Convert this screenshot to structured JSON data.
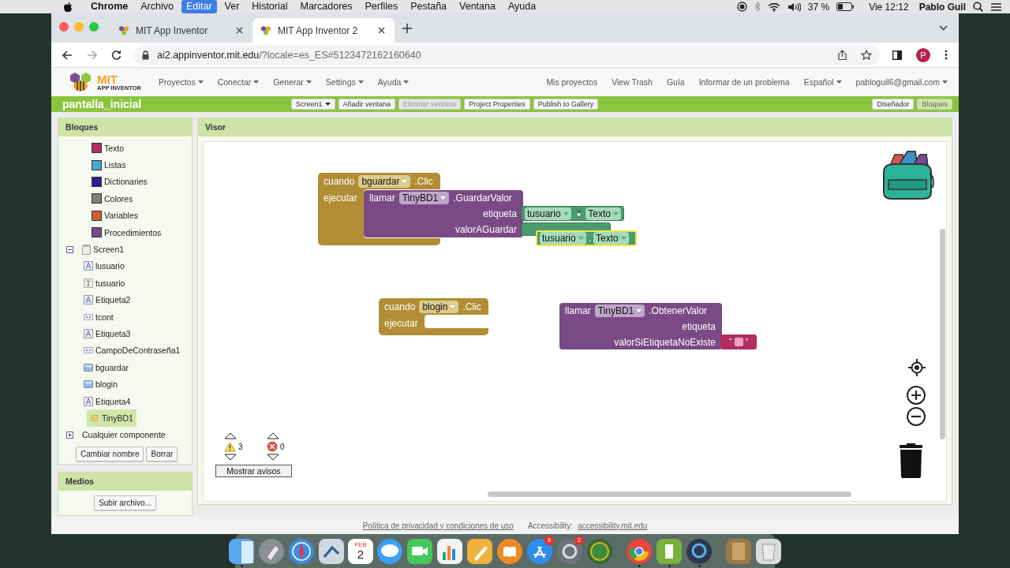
{
  "menubar": {
    "app_name": "Chrome",
    "menus": [
      {
        "label": "Archivo",
        "selected": false
      },
      {
        "label": "Editar",
        "selected": true
      },
      {
        "label": "Ver",
        "selected": false
      },
      {
        "label": "Historial",
        "selected": false
      },
      {
        "label": "Marcadores",
        "selected": false
      },
      {
        "label": "Perfiles",
        "selected": false
      },
      {
        "label": "Pestaña",
        "selected": false
      },
      {
        "label": "Ventana",
        "selected": false
      },
      {
        "label": "Ayuda",
        "selected": false
      }
    ],
    "battery": "37 %",
    "clock": "Vie 12:12",
    "user": "Pablo Guil"
  },
  "browser": {
    "tabs": [
      {
        "title": "MIT App Inventor",
        "selected": false
      },
      {
        "title": "MIT App Inventor 2",
        "selected": true
      }
    ],
    "host": "ai2.appinventor.mit.edu",
    "path": "/?locale=es_ES#5123472162160640",
    "profile": "P"
  },
  "header": {
    "logo_title": "MIT",
    "logo_subtitle": "APP INVENTOR",
    "menus": [
      "Proyectos",
      "Conectar",
      "Generar",
      "Settings",
      "Ayuda"
    ],
    "links": [
      {
        "label": "Mis proyectos",
        "kind": "link"
      },
      {
        "label": "View Trash",
        "kind": "link"
      },
      {
        "label": "Guía",
        "kind": "link"
      },
      {
        "label": "Informar de un problema",
        "kind": "link"
      },
      {
        "label": "Español",
        "kind": "dropdown"
      },
      {
        "label": "pabloguil6@gmail.com",
        "kind": "dropdown"
      }
    ]
  },
  "project_bar": {
    "project": "pantalla_inicial",
    "screen": "Screen1",
    "buttons": [
      {
        "label": "Añadir ventana",
        "disabled": false
      },
      {
        "label": "Eliminar ventana",
        "disabled": true
      },
      {
        "label": "Project Properties",
        "disabled": false
      },
      {
        "label": "Publish to Gallery",
        "disabled": false
      }
    ],
    "views": [
      {
        "label": "Diseñador",
        "selected": false
      },
      {
        "label": "Bloques",
        "selected": true
      }
    ]
  },
  "blocks_panel": {
    "title": "Bloques",
    "categories": [
      {
        "label": "Texto",
        "color": "#b32d5e"
      },
      {
        "label": "Listas",
        "color": "#4aa8d6"
      },
      {
        "label": "Dictionaries",
        "color": "#2d1f8c"
      },
      {
        "label": "Colores",
        "color": "#7f7f7f"
      },
      {
        "label": "Variables",
        "color": "#d2602d"
      },
      {
        "label": "Procedimientos",
        "color": "#7c4c8a"
      }
    ],
    "components": [
      {
        "label": "Screen1",
        "kind": "screen",
        "expanded": true,
        "selected": false,
        "children": [
          {
            "label": "lusuario",
            "kind": "label",
            "selected": false
          },
          {
            "label": "tusuario",
            "kind": "textbox",
            "selected": false
          },
          {
            "label": "Etiqueta2",
            "kind": "label",
            "selected": false
          },
          {
            "label": "tcont",
            "kind": "password",
            "selected": false
          },
          {
            "label": "Etiqueta3",
            "kind": "label",
            "selected": false
          },
          {
            "label": "CampoDeContraseña1",
            "kind": "password",
            "selected": false
          },
          {
            "label": "bguardar",
            "kind": "button",
            "selected": false
          },
          {
            "label": "blogin",
            "kind": "button",
            "selected": false
          },
          {
            "label": "Etiqueta4",
            "kind": "label",
            "selected": false
          },
          {
            "label": "TinyBD1",
            "kind": "database",
            "selected": true
          }
        ]
      },
      {
        "label": "Cualquier componente",
        "kind": "group",
        "expanded": false,
        "selected": false
      }
    ],
    "buttons": [
      "Cambiar nombre",
      "Borrar"
    ]
  },
  "media_panel": {
    "title": "Medios",
    "button": "Subir archivo..."
  },
  "viewer": {
    "title": "Visor",
    "blocks": [
      {
        "kind": "event",
        "keyword": "cuando",
        "component": "bguardar",
        "event": ".Clic",
        "body": "ejecutar"
      },
      {
        "kind": "call",
        "keyword": "llamar",
        "component": "TinyBD1",
        "method": ".GuardarValor",
        "params": [
          "etiqueta",
          "valorAGuardar"
        ]
      },
      {
        "kind": "getter",
        "component": "tusuario",
        "property": "Texto",
        "selected": false,
        "cursor": true
      },
      {
        "kind": "covered"
      },
      {
        "kind": "getter",
        "component": "tusuario",
        "dot": ".",
        "property": "Texto",
        "selected": true
      },
      {
        "kind": "event",
        "keyword": "cuando",
        "component": "blogin",
        "event": ".Clic",
        "body": "ejecutar"
      },
      {
        "kind": "call",
        "keyword": "llamar",
        "component": "TinyBD1",
        "method": ".ObtenerValor",
        "params": [
          "etiqueta",
          "valorSiEtiquetaNoExiste"
        ]
      },
      {
        "kind": "text",
        "open": "“",
        "close": "”"
      }
    ],
    "warnings": "3",
    "errors": "0",
    "warnings_button": "Mostrar avisos"
  },
  "footer": {
    "privacy_link": "Política de privacidad y condiciones de uso",
    "accessibility_label": "Accessibility:",
    "accessibility_link": "accessibility.mit.edu"
  },
  "dock": {
    "items": [
      {
        "kind": "finder",
        "running": true
      },
      {
        "kind": "launchpad"
      },
      {
        "kind": "safari"
      },
      {
        "kind": "mail"
      },
      {
        "kind": "calendar",
        "month": "FEB",
        "day": "2"
      },
      {
        "kind": "messages"
      },
      {
        "kind": "facetime"
      },
      {
        "kind": "numbers"
      },
      {
        "kind": "pages"
      },
      {
        "kind": "books"
      },
      {
        "kind": "appstore",
        "badge": "9"
      },
      {
        "kind": "settings",
        "badge": "2"
      },
      {
        "kind": "globe"
      },
      {
        "kind": "separator"
      },
      {
        "kind": "chrome",
        "running": true
      },
      {
        "kind": "green_app",
        "running": true
      },
      {
        "kind": "quicktime",
        "running": true
      },
      {
        "kind": "separator"
      },
      {
        "kind": "notebook"
      },
      {
        "kind": "trash"
      }
    ]
  }
}
